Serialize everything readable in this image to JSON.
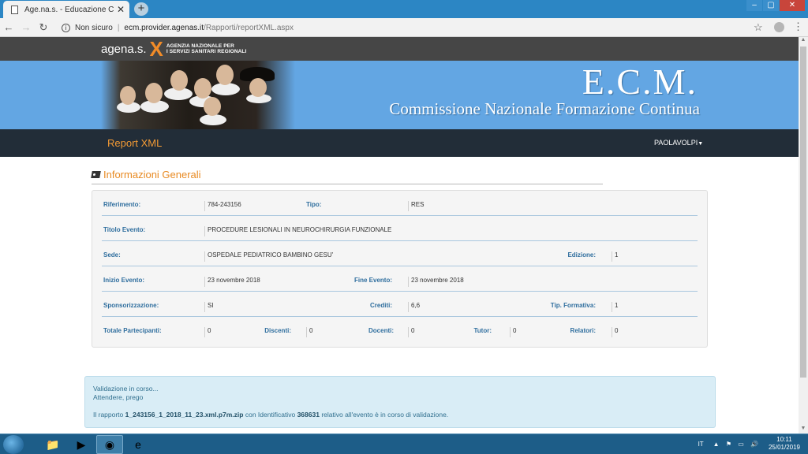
{
  "browser": {
    "tab_title": "Age.na.s. - Educazione Continua",
    "tab_close": "✕",
    "new_tab": "+",
    "security": "Non sicuro",
    "url_host": "ecm.provider.agenas.it",
    "url_path": "/Rapporti/reportXML.aspx"
  },
  "header": {
    "logo": "agena.s.",
    "logo_sub_line1": "AGENZIA NAZIONALE PER",
    "logo_sub_line2": "I SERVIZI SANITARI REGIONALI",
    "banner_title": "E.C.M.",
    "banner_subtitle": "Commissione Nazionale Formazione Continua"
  },
  "nav": {
    "brand": "Report XML",
    "user": "PAOLAVOLPI"
  },
  "section": {
    "title": "Informazioni Generali"
  },
  "info": {
    "riferimento_label": "Riferimento:",
    "riferimento_value": "784-243156",
    "tipo_label": "Tipo:",
    "tipo_value": "RES",
    "titolo_label": "Titolo Evento:",
    "titolo_value": "PROCEDURE LESIONALI IN NEUROCHIRURGIA FUNZIONALE",
    "sede_label": "Sede:",
    "sede_value": "OSPEDALE PEDIATRICO BAMBINO GESU'",
    "edizione_label": "Edizione:",
    "edizione_value": "1",
    "inizio_label": "Inizio Evento:",
    "inizio_value": "23 novembre 2018",
    "fine_label": "Fine Evento:",
    "fine_value": "23 novembre 2018",
    "sponsor_label": "Sponsorizzazione:",
    "sponsor_value": "SI",
    "crediti_label": "Crediti:",
    "crediti_value": "6,6",
    "tipform_label": "Tip. Formativa:",
    "tipform_value": "1",
    "totale_label": "Totale Partecipanti:",
    "totale_value": "0",
    "discenti_label": "Discenti:",
    "discenti_value": "0",
    "docenti_label": "Docenti:",
    "docenti_value": "0",
    "tutor_label": "Tutor:",
    "tutor_value": "0",
    "relatori_label": "Relatori:",
    "relatori_value": "0"
  },
  "alert": {
    "line1": "Validazione in corso...",
    "line2": "Attendere, prego",
    "msg_prefix": "Il rapporto",
    "filename": "1_243156_1_2018_11_23.xml.p7m.zip",
    "msg_mid": "con Identificativo",
    "identifier": "368631",
    "msg_suffix": "relativo all'evento è in corso di validazione."
  },
  "taskbar": {
    "language": "IT",
    "time": "10:11",
    "date": "25/01/2019"
  }
}
